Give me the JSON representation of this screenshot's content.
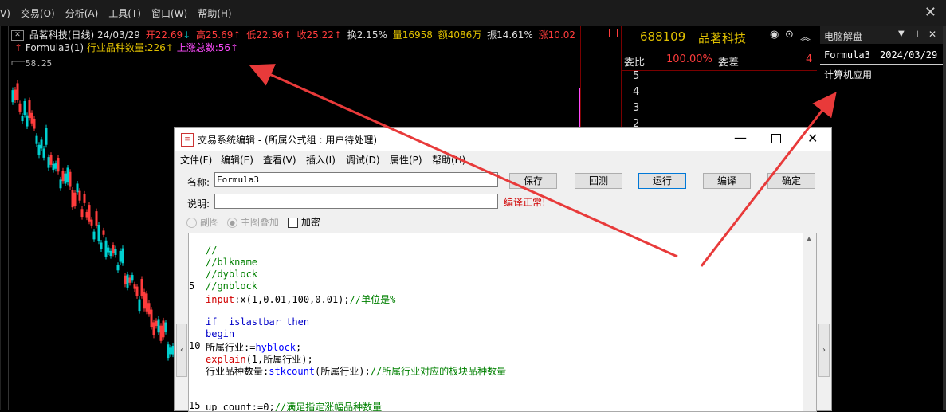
{
  "menu": [
    "V)",
    "交易(O)",
    "分析(A)",
    "工具(T)",
    "窗口(W)",
    "帮助(H)"
  ],
  "close_glyph": "✕",
  "stock_info": {
    "name": "品茗科技(日线) 24/03/29",
    "open": "开22.69",
    "high": "高25.69",
    "low": "低22.36",
    "close": "收25.22",
    "turnover": "换2.15%",
    "volume": "量16958",
    "amount": "额4086万",
    "amplitude": "振14.61%",
    "change": "涨10.02"
  },
  "formula_line": {
    "name": "Formula3(1)",
    "industry_count": "行业品种数量:226",
    "up_total": "上涨总数:56"
  },
  "price_top": "58.25",
  "quote": {
    "code": "688109",
    "name": "品茗科技",
    "weibi_label": "委比",
    "weibi_value": "100.00%",
    "weicha_label": "委差",
    "weicha_value": "4",
    "levels": [
      "5",
      "4",
      "3",
      "2"
    ]
  },
  "right_panel": {
    "title": "电脑解盘",
    "formula": "Formula3",
    "date": "2024/03/29",
    "industry": "计算机应用"
  },
  "dialog": {
    "title": "交易系统编辑 - (所属公式组 : 用户待处理)",
    "menu": [
      "文件(F)",
      "编辑(E)",
      "查看(V)",
      "插入(I)",
      "调试(D)",
      "属性(P)",
      "帮助(H)"
    ],
    "name_label": "名称:",
    "name_value": "Formula3",
    "desc_label": "说明:",
    "desc_value": "",
    "compile_status": "编译正常!",
    "btn_save": "保存",
    "btn_backtest": "回测",
    "btn_run": "运行",
    "btn_compile": "编译",
    "btn_ok": "确定",
    "radio_sub": "副图",
    "radio_main": "主图叠加",
    "chk_encrypt": "加密",
    "code_lines": [
      {
        "n": "",
        "t": "//"
      },
      {
        "n": "",
        "t": "//blkname"
      },
      {
        "n": "",
        "t": "//dyblock"
      },
      {
        "n": "5",
        "t": "//gnblock"
      },
      {
        "n": "",
        "t": "input:x(1,0.01,100,0.01);//单位是%"
      },
      {
        "n": "",
        "t": ""
      },
      {
        "n": "",
        "t": "if  islastbar then"
      },
      {
        "n": "",
        "t": "begin"
      },
      {
        "n": "10",
        "t": "所属行业:=hyblock;"
      },
      {
        "n": "",
        "t": "explain(1,所属行业);"
      },
      {
        "n": "",
        "t": "行业品种数量:stkcount(所属行业);//所属行业对应的板块品种数量"
      },
      {
        "n": "",
        "t": ""
      },
      {
        "n": "",
        "t": ""
      },
      {
        "n": "15",
        "t": "up_count:=0;//满足指定涨幅品种数量"
      }
    ]
  },
  "colors": {
    "up_red": "#ff3c3c",
    "down_green": "#00d0d0",
    "accent_yellow": "#e0c000",
    "magenta": "#ff4cff",
    "arrow_red": "#e83a3a"
  }
}
